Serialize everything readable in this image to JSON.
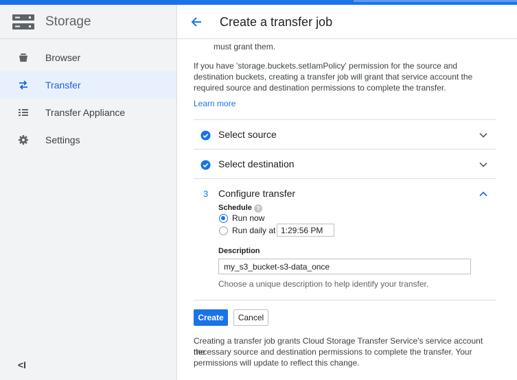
{
  "sidebar": {
    "title": "Storage",
    "items": [
      {
        "label": "Browser",
        "icon": "bucket-icon"
      },
      {
        "label": "Transfer",
        "icon": "transfer-arrows-icon",
        "active": true
      },
      {
        "label": "Transfer Appliance",
        "icon": "list-icon"
      },
      {
        "label": "Settings",
        "icon": "gear-icon"
      }
    ],
    "collapse_label": "<I"
  },
  "header": {
    "title": "Create a transfer job"
  },
  "intro": {
    "cut_line": "must grant them.",
    "paragraph_line1": "If you have 'storage.buckets.setIamPolicy' permission for the source and",
    "paragraph_line2": "destination buckets, creating a transfer job will grant that service account the",
    "paragraph_line3": "required source and destination permissions to complete the transfer.",
    "learn_more": "Learn more"
  },
  "steps": [
    {
      "label": "Select source",
      "status": "complete"
    },
    {
      "label": "Select destination",
      "status": "complete"
    },
    {
      "label": "Configure transfer",
      "number": "3",
      "status": "active"
    }
  ],
  "configure": {
    "schedule_label": "Schedule",
    "help_glyph": "?",
    "run_now_label": "Run now",
    "run_daily_label": "Run daily at",
    "run_daily_time": "1:29:56 PM",
    "selected": "run_now",
    "description_label": "Description",
    "description_value": "my_s3_bucket-s3-data_once",
    "description_hint": "Choose a unique description to help identify your transfer."
  },
  "actions": {
    "create_label": "Create",
    "cancel_label": "Cancel"
  },
  "footer": {
    "line1": "Creating a transfer job grants Cloud Storage Transfer Service's service account the",
    "line2": "necessary source and destination permissions to complete the transfer. Your",
    "line3": "permissions will update to reflect this change."
  },
  "colors": {
    "accent": "#1a73e8",
    "sidebar_bg": "#f1f3f4",
    "active_bg": "#e8f0fe"
  }
}
